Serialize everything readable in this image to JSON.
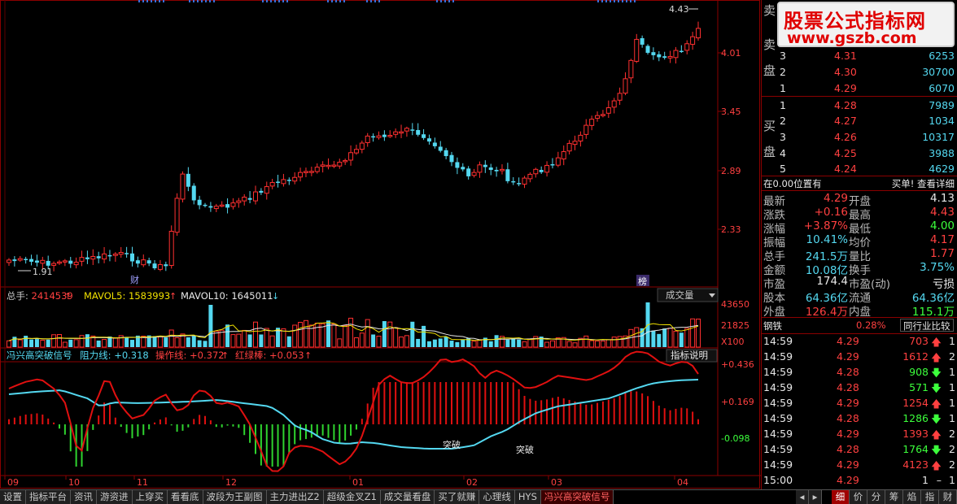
{
  "price_axis": [
    "4.01",
    "3.45",
    "2.89",
    "2.33"
  ],
  "price_annotations": {
    "high": "4.43",
    "low": "1.91"
  },
  "event_markers": [
    "财",
    "榜"
  ],
  "volume_panel": {
    "total_label": "总手:",
    "total_value": "2414539",
    "mavol5_label": "MAVOL5:",
    "mavol5_value": "1583993",
    "mavol10_label": "MAVOL10:",
    "mavol10_value": "1645011",
    "selector": "成交量",
    "axis": [
      "43650",
      "21825"
    ],
    "unit": "X100"
  },
  "indicator_panel": {
    "name": "冯兴高突破信号",
    "resistance_label": "阻力线:",
    "resistance_value": "+0.318",
    "operation_label": "操作线:",
    "operation_value": "+0.372",
    "bar_label": "红绿棒:",
    "bar_value": "+0.053",
    "help_button": "指标说明",
    "axis": [
      "+0.436",
      "+0.169",
      "-0.098"
    ],
    "signal_label": "突破"
  },
  "time_axis": [
    "09",
    "10",
    "11",
    "12",
    "01",
    "02",
    "03",
    "04"
  ],
  "watermark": {
    "title": "股票公式指标网",
    "url": "www.gszb.com"
  },
  "side_labels": {
    "sell_1": "卖",
    "sell_2": "盘",
    "buy_1": "买",
    "buy_2": "盘"
  },
  "sell_orders": [
    {
      "level": "3",
      "price": "4.31",
      "volume": "6253"
    },
    {
      "level": "2",
      "price": "4.30",
      "volume": "30700"
    },
    {
      "level": "1",
      "price": "4.29",
      "volume": "6070"
    }
  ],
  "buy_orders": [
    {
      "level": "1",
      "price": "4.28",
      "volume": "7989"
    },
    {
      "level": "2",
      "price": "4.27",
      "volume": "1034"
    },
    {
      "level": "3",
      "price": "4.26",
      "volume": "10317"
    },
    {
      "level": "4",
      "price": "4.25",
      "volume": "3988"
    },
    {
      "level": "5",
      "price": "4.24",
      "volume": "4629"
    }
  ],
  "position_row": {
    "label": "在0.00位置有",
    "link": "买单! 查看详细"
  },
  "quote": [
    {
      "l1": "最新",
      "v1": "4.29",
      "l2": "开盘",
      "v2": "4.13"
    },
    {
      "l1": "涨跌",
      "v1": "+0.16",
      "l2": "最高",
      "v2": "4.43"
    },
    {
      "l1": "涨幅",
      "v1": "+3.87%",
      "l2": "最低",
      "v2": "4.00"
    },
    {
      "l1": "振幅",
      "v1": "10.41%",
      "l2": "均价",
      "v2": "4.17"
    },
    {
      "l1": "总手",
      "v1": "241.5万",
      "l2": "量比",
      "v2": "1.77"
    },
    {
      "l1": "金额",
      "v1": "10.08亿",
      "l2": "换手",
      "v2": "3.75%"
    },
    {
      "l1": "市盈",
      "v1": "174.4",
      "l2": "市盈(动)",
      "v2": "亏损"
    },
    {
      "l1": "股本",
      "v1": "64.36亿",
      "l2": "流通",
      "v2": "64.36亿"
    },
    {
      "l1": "外盘",
      "v1": "126.4万",
      "l2": "内盘",
      "v2": "115.1万"
    }
  ],
  "industry": {
    "name": "钢铁",
    "change": "0.28%",
    "button": "同行业比较"
  },
  "ticks": [
    {
      "time": "14:59",
      "price": "4.29",
      "vol": "703",
      "dir": "up",
      "n": "1"
    },
    {
      "time": "14:59",
      "price": "4.29",
      "vol": "1612",
      "dir": "up",
      "n": "2"
    },
    {
      "time": "14:59",
      "price": "4.28",
      "vol": "908",
      "dir": "down",
      "n": "1"
    },
    {
      "time": "14:59",
      "price": "4.28",
      "vol": "571",
      "dir": "down",
      "n": "1"
    },
    {
      "time": "14:59",
      "price": "4.29",
      "vol": "1254",
      "dir": "up",
      "n": "1"
    },
    {
      "time": "14:59",
      "price": "4.28",
      "vol": "1286",
      "dir": "down",
      "n": "1"
    },
    {
      "time": "14:59",
      "price": "4.29",
      "vol": "1393",
      "dir": "up",
      "n": "2"
    },
    {
      "time": "14:59",
      "price": "4.28",
      "vol": "1764",
      "dir": "down",
      "n": "2"
    },
    {
      "time": "14:59",
      "price": "4.29",
      "vol": "4123",
      "dir": "up",
      "n": "2"
    },
    {
      "time": "15:00",
      "price": "4.29",
      "vol": "1",
      "dir": "none",
      "n": "1"
    }
  ],
  "bottom_tabs": [
    "设置",
    "指标平台",
    "资讯",
    "游资进",
    "上穿买",
    "看看底",
    "波段为王副图",
    "主力进出Z2",
    "超级金叉Z1",
    "成交量看盘",
    "买了就赚",
    "心理线",
    "HYS",
    "冯兴高突破信号"
  ],
  "active_tab": "冯兴高突破信号",
  "right_tabs": [
    "细",
    "价",
    "分",
    "筹",
    "焰",
    "指",
    "财"
  ],
  "colors": {
    "up": "#ff3030",
    "down": "#54d8f0",
    "bg": "#000000",
    "border": "#8b0000"
  },
  "icons": [
    "up-arrow-icon",
    "down-arrow-icon",
    "dropdown-triangle-icon",
    "scroll-left-icon",
    "scroll-right-icon"
  ]
}
